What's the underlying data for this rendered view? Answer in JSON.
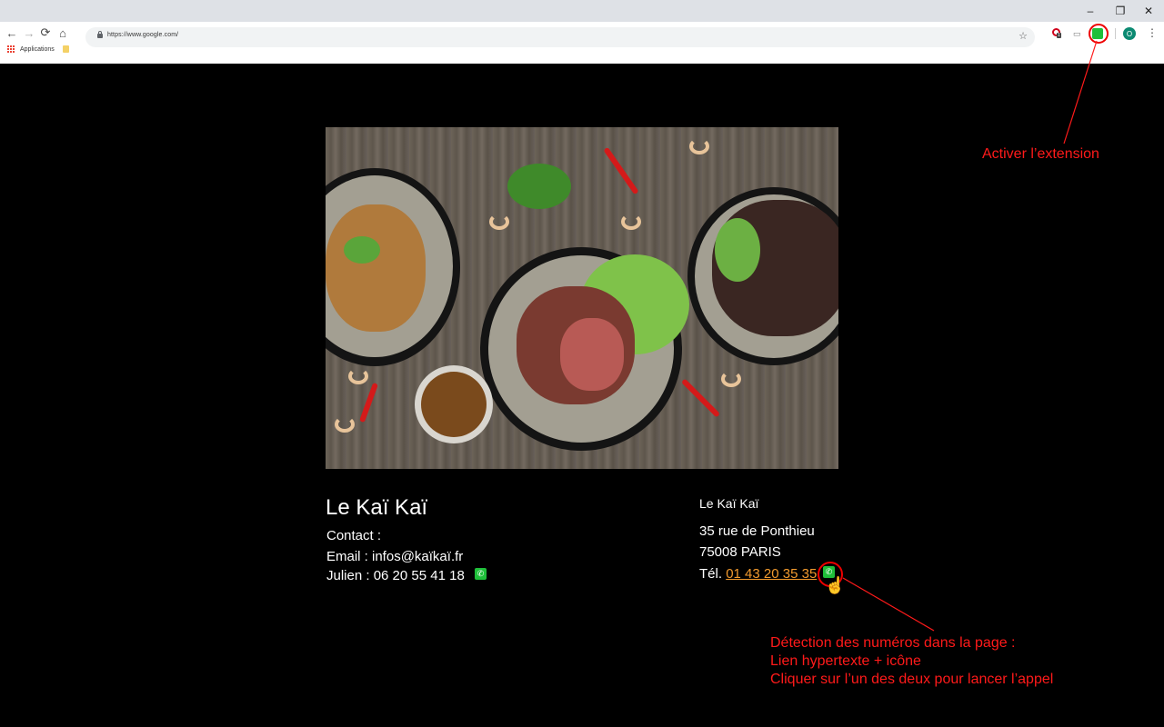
{
  "browser": {
    "url": "https://www.google.com/",
    "bookmarks_label": "Applications",
    "extension_badge": "1",
    "profile_initial": "O",
    "window_controls": {
      "minimize": "–",
      "restore": "❐",
      "close": "✕"
    },
    "nav": {
      "back": "←",
      "forward": "→",
      "reload": "⟳",
      "home": "⌂",
      "star": "☆",
      "menu": "⋮"
    }
  },
  "page": {
    "title": "Le Kaï Kaï",
    "contact": {
      "heading": "Contact :",
      "email": "Email : infos@kaïkaï.fr",
      "phone_label": "Julien : 06 20 55 41 18"
    },
    "address": {
      "name": "Le Kaï Kaï",
      "street": "35 rue de Ponthieu",
      "city": "75008 PARIS",
      "tel_label": "Tél.",
      "tel_number": "01 43 20 35 35"
    }
  },
  "annotations": {
    "extension": "Activer l’extension",
    "detection_1": "Détection des numéros dans la page :",
    "detection_2": "Lien hypertexte + icône",
    "detection_3": "Cliquer sur l’un des deux pour lancer l’appel"
  },
  "colors": {
    "annotation_red": "#ff1a1a",
    "link_orange": "#f29a2e",
    "extension_green": "#1fbf3a"
  }
}
